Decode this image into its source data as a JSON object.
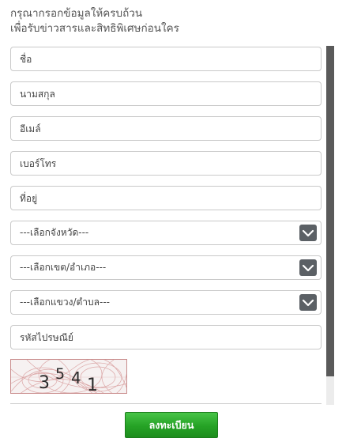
{
  "intro": {
    "line1": "กรุณากรอกข้อมูลให้ครบถ้วน",
    "line2": "เพื่อรับข่าวสารและสิทธิพิเศษก่อนใคร"
  },
  "form": {
    "name_placeholder": "ชื่อ",
    "surname_placeholder": "นามสกุล",
    "email_placeholder": "อีเมล์",
    "phone_placeholder": "เบอร์โทร",
    "address_placeholder": "ที่อยู่",
    "province_select": "---เลือกจังหวัด---",
    "district_select": "---เลือกเขต/อำเภอ---",
    "subdistrict_select": "---เลือกแขวง/ตำบล---",
    "postcode_placeholder": "รหัสไปรษณีย์"
  },
  "captcha": {
    "digits": [
      "3",
      "5",
      "4",
      "1"
    ]
  },
  "submit_label": "ลงทะเบียน",
  "colors": {
    "button_green": "#25a225",
    "select_arrow_bg": "#5b6065",
    "scrollbar_thumb": "#5a5a5a"
  }
}
